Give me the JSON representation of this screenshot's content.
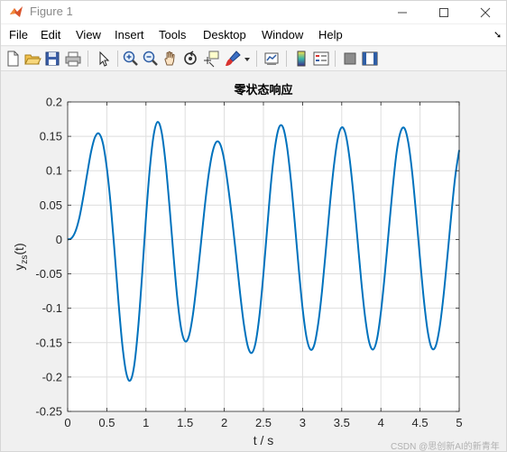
{
  "window": {
    "title": "Figure 1",
    "controls": [
      "minimize",
      "maximize",
      "close"
    ]
  },
  "menu": [
    "File",
    "Edit",
    "View",
    "Insert",
    "Tools",
    "Desktop",
    "Window",
    "Help"
  ],
  "toolbar": {
    "buttons": [
      "new-figure",
      "open-file",
      "save",
      "print",
      "edit-plot",
      "zoom-in",
      "zoom-out",
      "pan",
      "rotate-3d",
      "data-cursor",
      "brush",
      "brush-dropdown",
      "link-plot",
      "insert-colorbar",
      "insert-legend",
      "hide-plot-tools",
      "show-plot-tools"
    ]
  },
  "colors": {
    "line": "#0072bd",
    "grid": "#dedede",
    "axis": "#262626",
    "plot_bg": "#ffffff",
    "figure_bg": "#f0f0f0"
  },
  "chart_data": {
    "type": "line",
    "title": "零状态响应",
    "xlabel": "t / s",
    "ylabel_base": "y",
    "ylabel_sub": "zs",
    "ylabel_suffix": "(t)",
    "xlim": [
      0,
      5
    ],
    "ylim": [
      -0.25,
      0.2
    ],
    "xticks": [
      0,
      0.5,
      1,
      1.5,
      2,
      2.5,
      3,
      3.5,
      4,
      4.5,
      5
    ],
    "xtick_labels": [
      "0",
      "0.5",
      "1",
      "1.5",
      "2",
      "2.5",
      "3",
      "3.5",
      "4",
      "4.5",
      "5"
    ],
    "yticks": [
      -0.25,
      -0.2,
      -0.15,
      -0.1,
      -0.05,
      0,
      0.05,
      0.1,
      0.15,
      0.2
    ],
    "ytick_labels": [
      "-0.25",
      "-0.2",
      "-0.15",
      "-0.1",
      "-0.05",
      "0",
      "0.05",
      "0.1",
      "0.15",
      "0.2"
    ],
    "grid": true,
    "series": [
      {
        "x": [
          0,
          0.05,
          0.1,
          0.15,
          0.2,
          0.25,
          0.3,
          0.35,
          0.4,
          0.45,
          0.5,
          0.55,
          0.6,
          0.65,
          0.7,
          0.75,
          0.8,
          0.85,
          0.9,
          0.95,
          1.0,
          1.05,
          1.1,
          1.15,
          1.2,
          1.25,
          1.3,
          1.35,
          1.4,
          1.45,
          1.5,
          1.55,
          1.6,
          1.65,
          1.7,
          1.75,
          1.8,
          1.85,
          1.9,
          1.95,
          2.0,
          2.05,
          2.1,
          2.15,
          2.2,
          2.25,
          2.3,
          2.35,
          2.4,
          2.45,
          2.5,
          2.55,
          2.6,
          2.65,
          2.7,
          2.75,
          2.8,
          2.85,
          2.9,
          2.95,
          3.0,
          3.05,
          3.1,
          3.15,
          3.2,
          3.25,
          3.3,
          3.35,
          3.4,
          3.45,
          3.5,
          3.55,
          3.6,
          3.65,
          3.7,
          3.75,
          3.8,
          3.85,
          3.9,
          3.95,
          4.0,
          4.05,
          4.1,
          4.15,
          4.2,
          4.25,
          4.3,
          4.35,
          4.4,
          4.45,
          4.5,
          4.55,
          4.6,
          4.65,
          4.7,
          4.75,
          4.8,
          4.85,
          4.9,
          4.95,
          5.0
        ],
        "y": [
          0,
          0.002,
          0.012,
          0.032,
          0.062,
          0.096,
          0.128,
          0.149,
          0.154,
          0.14,
          0.104,
          0.05,
          -0.019,
          -0.092,
          -0.155,
          -0.195,
          -0.205,
          -0.183,
          -0.129,
          -0.053,
          0.032,
          0.104,
          0.153,
          0.171,
          0.156,
          0.112,
          0.049,
          -0.021,
          -0.085,
          -0.13,
          -0.148,
          -0.14,
          -0.109,
          -0.062,
          -0.008,
          0.047,
          0.094,
          0.127,
          0.142,
          0.138,
          0.115,
          0.076,
          0.03,
          -0.022,
          -0.076,
          -0.123,
          -0.155,
          -0.165,
          -0.15,
          -0.11,
          -0.05,
          0.019,
          0.086,
          0.136,
          0.163,
          0.163,
          0.136,
          0.087,
          0.025,
          -0.041,
          -0.1,
          -0.142,
          -0.16,
          -0.153,
          -0.122,
          -0.073,
          -0.012,
          0.052,
          0.107,
          0.147,
          0.163,
          0.153,
          0.118,
          0.065,
          0.002,
          -0.061,
          -0.114,
          -0.149,
          -0.16,
          -0.145,
          -0.106,
          -0.051,
          0.012,
          0.074,
          0.126,
          0.156,
          0.162,
          0.141,
          0.097,
          0.037,
          -0.028,
          -0.089,
          -0.135,
          -0.158,
          -0.155,
          -0.128,
          -0.082,
          -0.024,
          0.037,
          0.092,
          0.13
        ]
      }
    ]
  },
  "watermark": "CSDN @思创新AI的新青年"
}
